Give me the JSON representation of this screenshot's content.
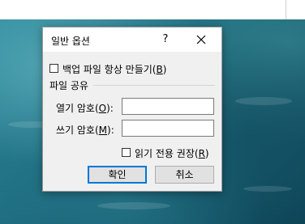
{
  "dialog": {
    "title": "일반 옵션",
    "help_label": "?",
    "backup_checkbox": {
      "label_before": "백업 파일 항상 만들기(",
      "accel": "B",
      "label_after": ")",
      "checked": false
    },
    "section_title": "파일 공유",
    "open_password": {
      "label_before": "열기 암호(",
      "accel": "O",
      "label_after": "):",
      "value": ""
    },
    "modify_password": {
      "label_before": "쓰기 암호(",
      "accel": "M",
      "label_after": "):",
      "value": ""
    },
    "readonly_checkbox": {
      "label_before": "읽기 전용 권장(",
      "accel": "R",
      "label_after": ")",
      "checked": false
    },
    "ok_label": "확인",
    "cancel_label": "취소"
  },
  "colors": {
    "accent": "#0078d7",
    "dialog_bg": "#f0f0f0",
    "titlebar_bg": "#ffffff",
    "button_bg": "#e1e1e1",
    "backdrop_water": "#1f6f82"
  },
  "icons": {
    "close": "close-icon"
  }
}
